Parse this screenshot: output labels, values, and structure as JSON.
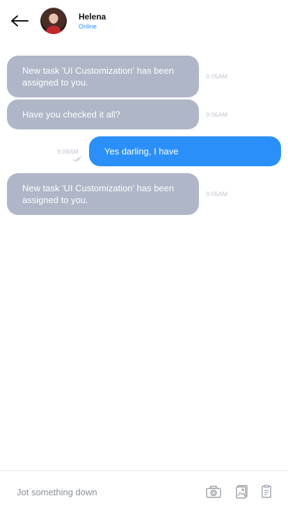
{
  "header": {
    "contact_name": "Helena",
    "contact_status": "Online"
  },
  "messages": [
    {
      "direction": "in",
      "text": "New task 'UI Customization' has been assigned to you.",
      "time": "9:05AM"
    },
    {
      "direction": "in",
      "text": "Have you checked it all?",
      "time": "9:06AM"
    },
    {
      "direction": "out",
      "text": "Yes darling, I have",
      "time": "9:08AM",
      "read_receipt": "double-check-icon"
    },
    {
      "direction": "in",
      "text": "New task 'UI Customization' has been assigned to you.",
      "time": "9:05AM"
    }
  ],
  "composer": {
    "placeholder": "Jot something down",
    "icons": [
      "camera-icon",
      "gallery-icon",
      "document-icon"
    ]
  },
  "colors": {
    "incoming_bubble": "#aeb6c7",
    "outgoing_bubble": "#2b8ff9",
    "status_online": "#2b8fff",
    "timestamp": "#c2c7d0"
  }
}
